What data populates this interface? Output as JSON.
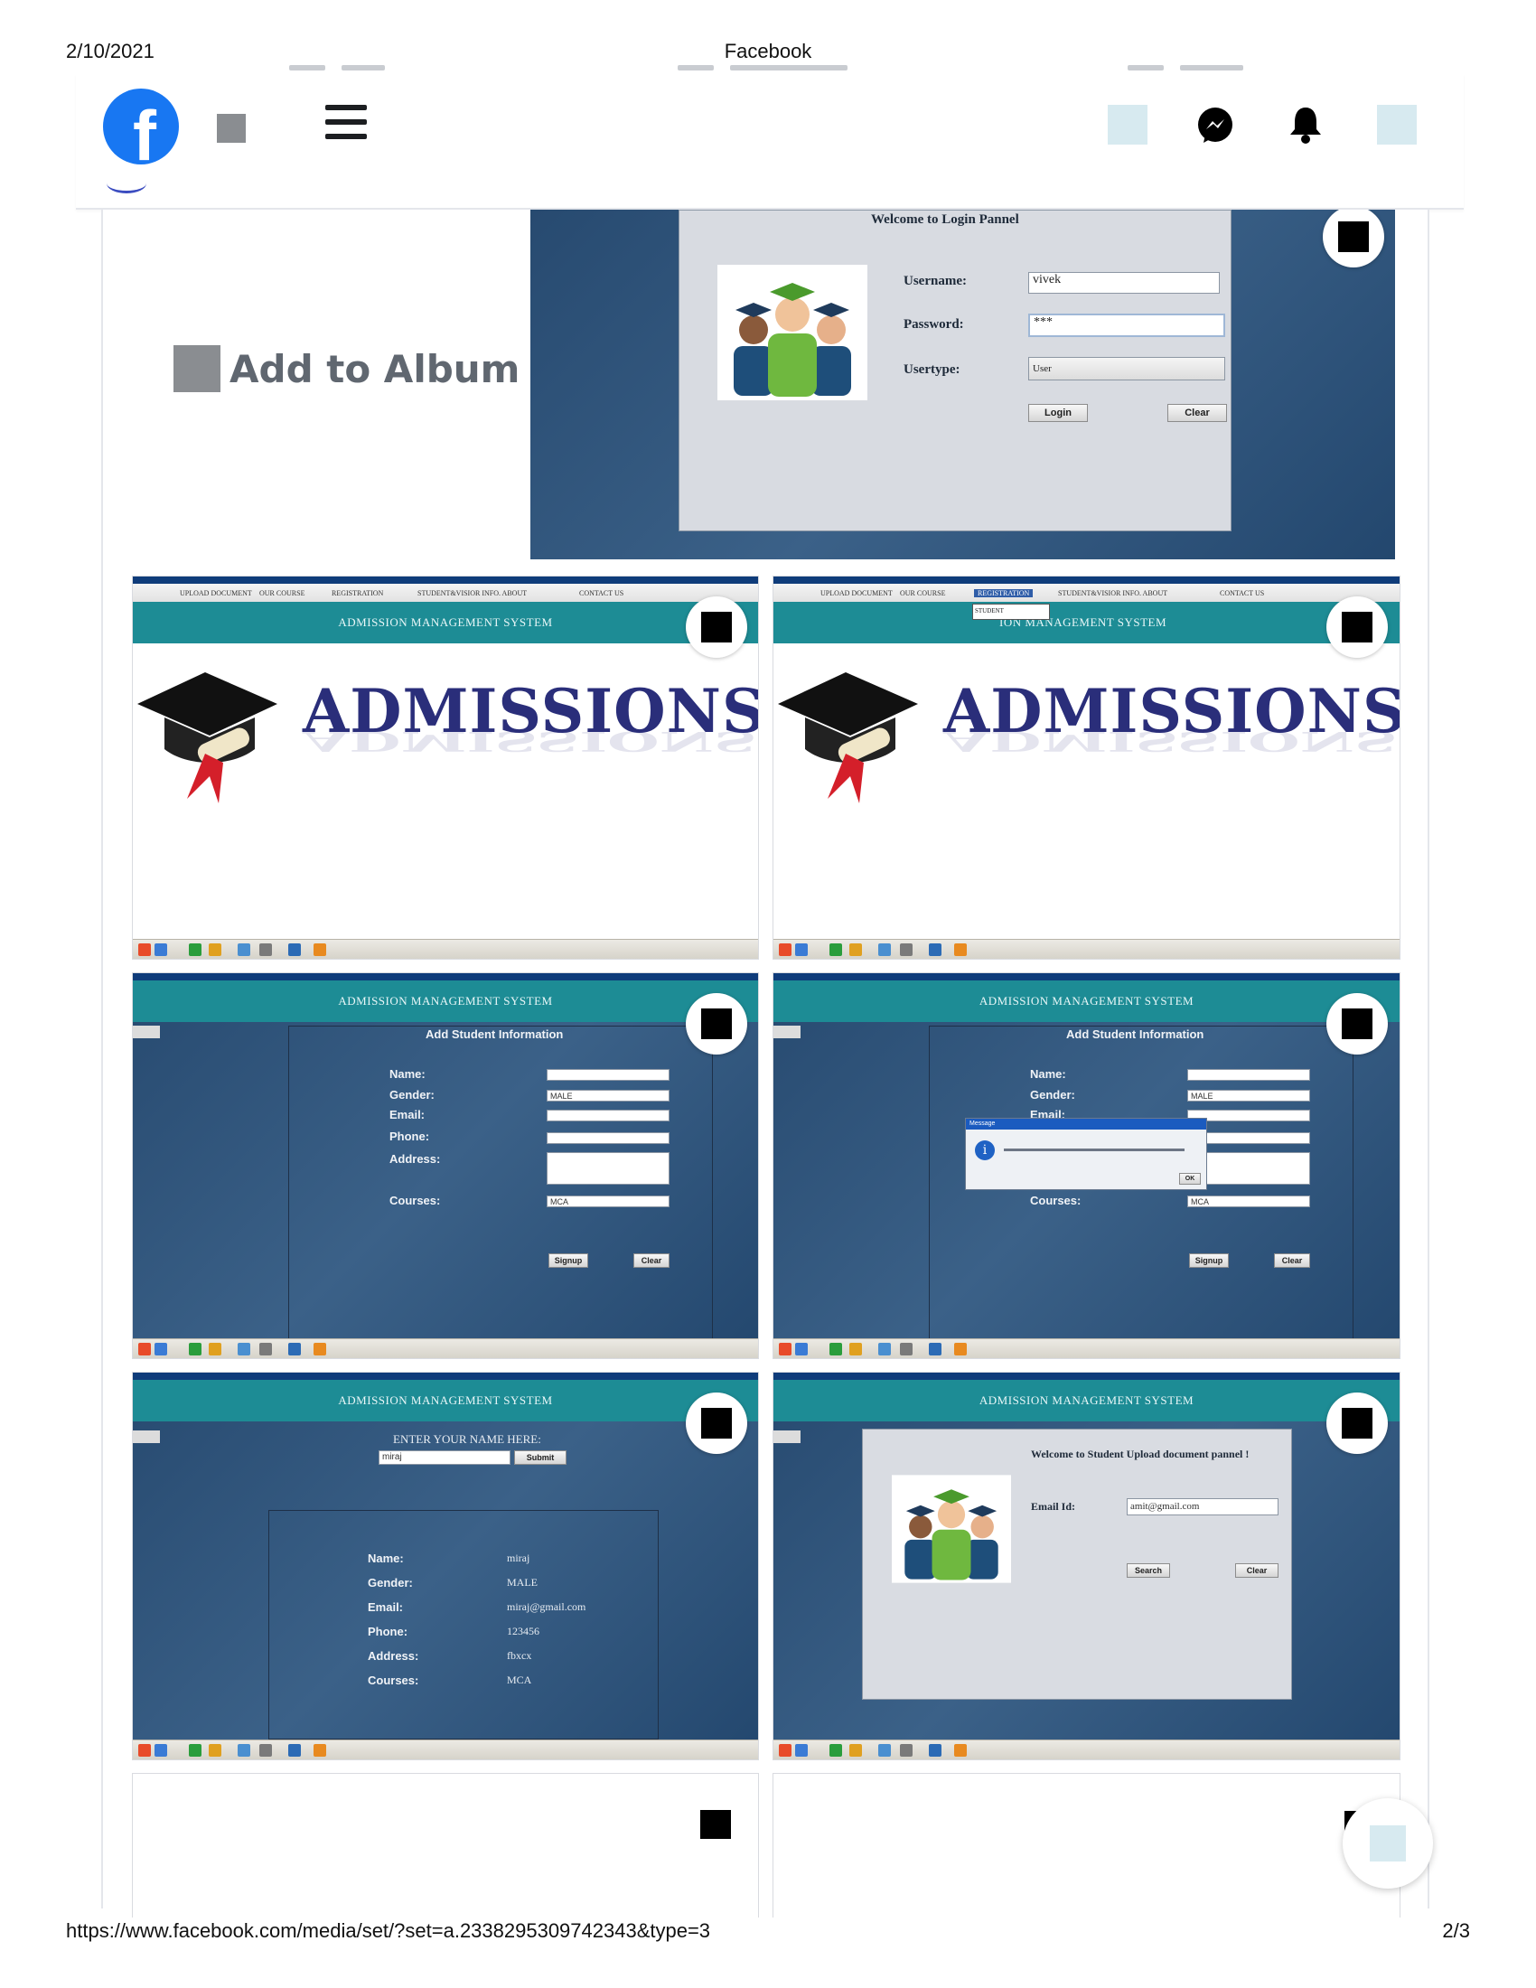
{
  "print": {
    "date": "2/10/2021",
    "title": "Facebook",
    "url": "https://www.facebook.com/media/set/?set=a.2338295309742343&type=3",
    "page": "2/3"
  },
  "topbar": {
    "logo_letter": "f",
    "icons": [
      "facebook-logo-icon",
      "search-icon",
      "menu-icon",
      "messenger-icon",
      "notifications-bell-icon"
    ]
  },
  "album": {
    "add_label": "Add to Album"
  },
  "photos": {
    "login": {
      "heading": "Welcome to Login Pannel",
      "username_label": "Username:",
      "username_value": "vivek",
      "password_label": "Password:",
      "password_value": "***",
      "usertype_label": "Usertype:",
      "usertype_value": "User",
      "login_button": "Login",
      "clear_button": "Clear"
    },
    "admissions": {
      "menu_items": [
        "UPLOAD DOCUMENT",
        "OUR COURSE",
        "REGISTRATION",
        "STUDENT&VISIOR INFO. ABOUT",
        "CONTACT US"
      ],
      "banner": "ADMISSION MANAGEMENT SYSTEM",
      "banner_partial": "ION MANAGEMENT SYSTEM",
      "headline": "ADMISSIONS",
      "dropdown_item": "STUDENT"
    },
    "add_student": {
      "banner": "ADMISSION MANAGEMENT SYSTEM",
      "heading": "Add Student Information",
      "name_label": "Name:",
      "gender_label": "Gender:",
      "email_label": "Email:",
      "phone_label": "Phone:",
      "address_label": "Address:",
      "courses_label": "Courses:",
      "gender_value": "MALE",
      "courses_value": "MCA",
      "signup_button": "Signup",
      "clear_button": "Clear",
      "message_title": "Message",
      "message_ok": "OK"
    },
    "search": {
      "banner": "ADMISSION MANAGEMENT SYSTEM",
      "prompt": "ENTER YOUR NAME HERE:",
      "input_value": "miraj",
      "submit_button": "Submit",
      "rows": [
        {
          "label": "Name:",
          "value": "miraj"
        },
        {
          "label": "Gender:",
          "value": "MALE"
        },
        {
          "label": "Email:",
          "value": "miraj@gmail.com"
        },
        {
          "label": "Phone:",
          "value": "123456"
        },
        {
          "label": "Address:",
          "value": "fbxcx"
        },
        {
          "label": "Courses:",
          "value": "MCA"
        }
      ]
    },
    "upload": {
      "banner": "ADMISSION MANAGEMENT SYSTEM",
      "heading": "Welcome to Student Upload document pannel !",
      "email_label": "Email Id:",
      "email_value": "amit@gmail.com",
      "search_button": "Search",
      "clear_button": "Clear"
    }
  }
}
